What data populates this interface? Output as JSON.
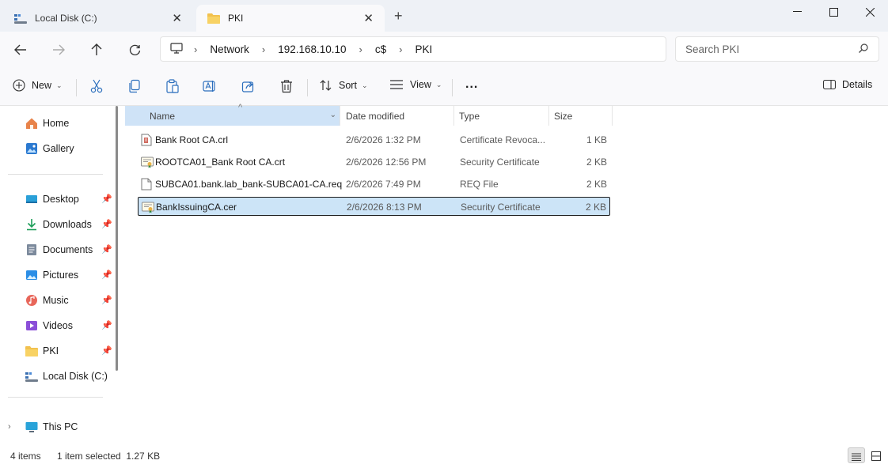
{
  "tabs": [
    {
      "label": "Local Disk (C:)",
      "icon": "drive-icon",
      "active": false
    },
    {
      "label": "PKI",
      "icon": "folder-icon",
      "active": true
    }
  ],
  "window_controls": {
    "minimize": "minimize",
    "maximize": "maximize",
    "close": "close"
  },
  "address": {
    "breadcrumbs": [
      "Network",
      "192.168.10.10",
      "c$",
      "PKI"
    ]
  },
  "search": {
    "placeholder": "Search PKI"
  },
  "toolbar": {
    "new_label": "New",
    "sort_label": "Sort",
    "view_label": "View",
    "more_label": "...",
    "details_label": "Details"
  },
  "sidebar": {
    "quick": [
      {
        "label": "Home",
        "icon": "home-icon"
      },
      {
        "label": "Gallery",
        "icon": "gallery-icon"
      }
    ],
    "pinned": [
      {
        "label": "Desktop",
        "icon": "desktop-icon"
      },
      {
        "label": "Downloads",
        "icon": "downloads-icon"
      },
      {
        "label": "Documents",
        "icon": "documents-icon"
      },
      {
        "label": "Pictures",
        "icon": "pictures-icon"
      },
      {
        "label": "Music",
        "icon": "music-icon"
      },
      {
        "label": "Videos",
        "icon": "videos-icon"
      },
      {
        "label": "PKI",
        "icon": "folder-icon"
      },
      {
        "label": "Local Disk (C:)",
        "icon": "drive-icon"
      }
    ],
    "this_pc": {
      "label": "This PC",
      "icon": "computer-icon"
    }
  },
  "columns": [
    "Name",
    "Date modified",
    "Type",
    "Size"
  ],
  "files": [
    {
      "name": "Bank Root CA.crl",
      "date": "2/6/2026 1:32 PM",
      "type": "Certificate Revoca...",
      "size": "1 KB",
      "icon": "crl-file-icon",
      "selected": false
    },
    {
      "name": "ROOTCA01_Bank Root CA.crt",
      "date": "2/6/2026 12:56 PM",
      "type": "Security Certificate",
      "size": "2 KB",
      "icon": "certificate-file-icon",
      "selected": false
    },
    {
      "name": "SUBCA01.bank.lab_bank-SUBCA01-CA.req",
      "date": "2/6/2026 7:49 PM",
      "type": "REQ File",
      "size": "2 KB",
      "icon": "generic-file-icon",
      "selected": false
    },
    {
      "name": "BankIssuingCA.cer",
      "date": "2/6/2026 8:13 PM",
      "type": "Security Certificate",
      "size": "2 KB",
      "icon": "certificate-file-icon",
      "selected": true
    }
  ],
  "status": {
    "item_count": "4 items",
    "selection": "1 item selected  1.27 KB"
  }
}
